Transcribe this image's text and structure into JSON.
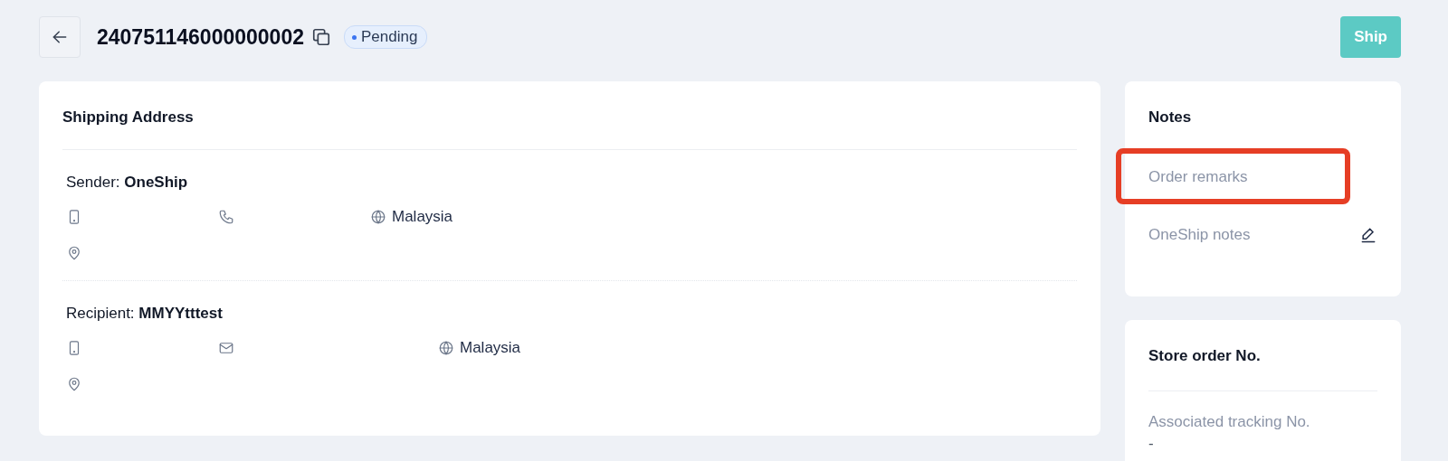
{
  "header": {
    "title": "240751146000000002",
    "status": {
      "label": "Pending"
    },
    "ship_button": "Ship"
  },
  "shipping_address": {
    "title": "Shipping Address",
    "parties": [
      {
        "role": "Sender:",
        "name": "OneShip",
        "contacts": [
          {
            "kind": "mobile"
          },
          {
            "kind": "phone"
          },
          {
            "kind": "country",
            "text": "Malaysia"
          }
        ]
      },
      {
        "role": "Recipient:",
        "name": "MMYYtttest",
        "contacts": [
          {
            "kind": "mobile"
          },
          {
            "kind": "email"
          },
          {
            "kind": "country",
            "text": "Malaysia"
          }
        ]
      }
    ]
  },
  "notes": {
    "title": "Notes",
    "items": [
      {
        "label": "Order remarks",
        "highlighted": true,
        "editable": false
      },
      {
        "label": "OneShip notes",
        "highlighted": false,
        "editable": true
      }
    ]
  },
  "store_order": {
    "title": "Store order No.",
    "fields": [
      {
        "label": "Associated tracking No.",
        "value": "-"
      }
    ]
  }
}
